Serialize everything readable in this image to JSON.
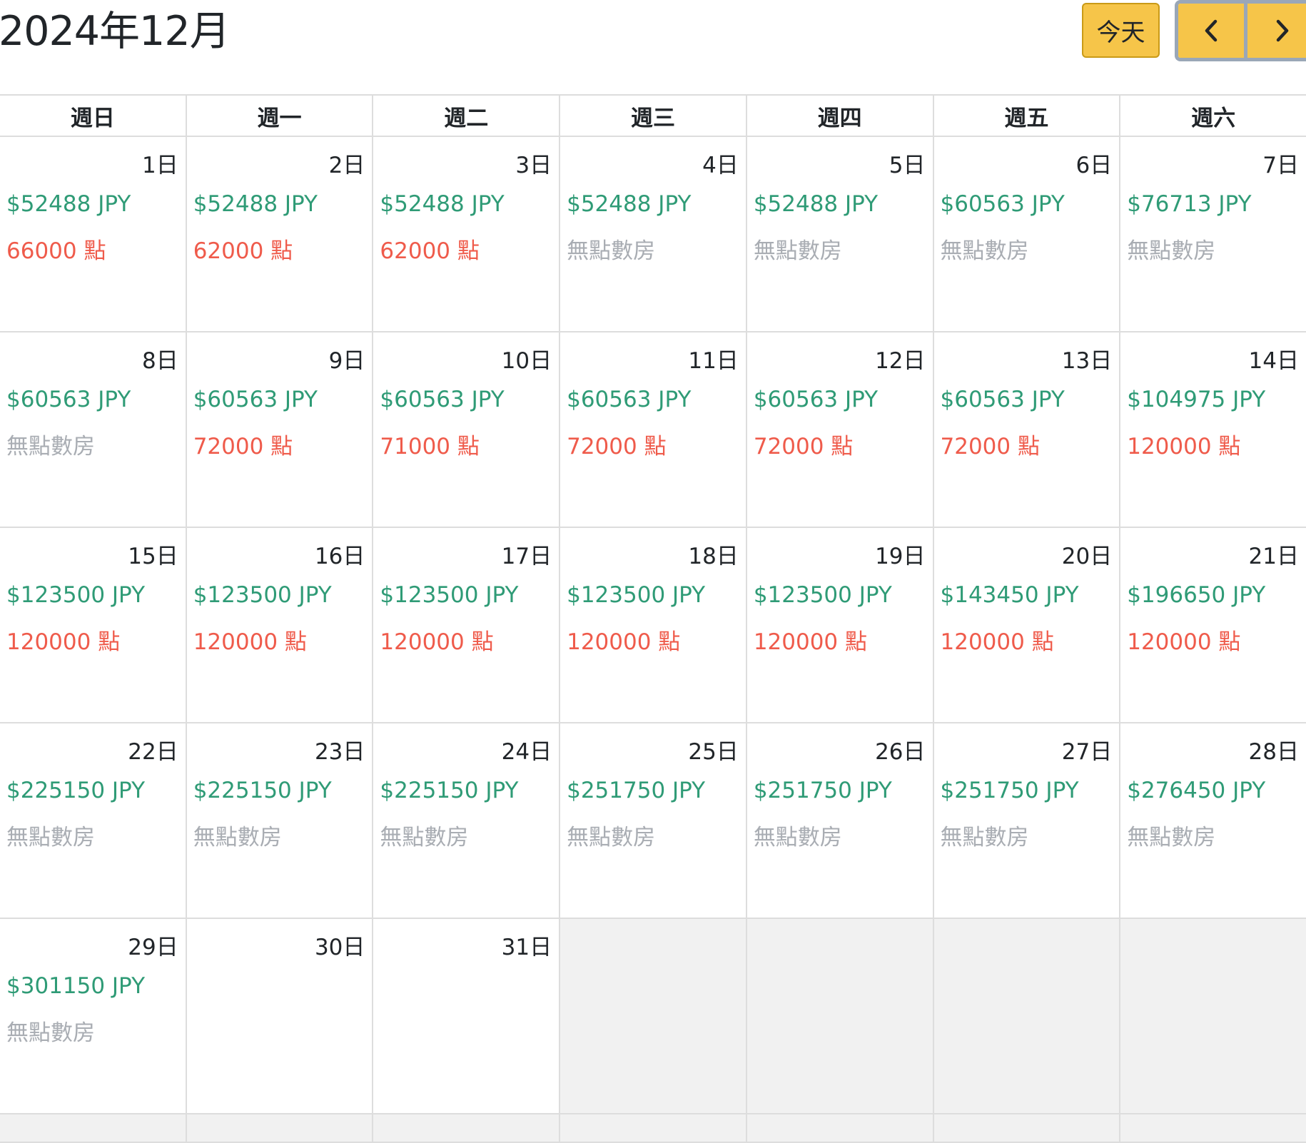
{
  "header": {
    "title": "2024年12月",
    "today_label": "今天",
    "prev_icon": "chevron-left-icon",
    "next_icon": "chevron-right-icon"
  },
  "colors": {
    "button_bg": "#f6c549",
    "price": "#2f9b76",
    "points": "#ef5b4b",
    "no_points": "#a9adb3",
    "empty_cell": "#f1f1f1"
  },
  "weekdays": [
    "週日",
    "週一",
    "週二",
    "週三",
    "週四",
    "週五",
    "週六"
  ],
  "days": [
    {
      "day": "1日",
      "price": "$52488 JPY",
      "points": "66000 點",
      "has_points": true
    },
    {
      "day": "2日",
      "price": "$52488 JPY",
      "points": "62000 點",
      "has_points": true
    },
    {
      "day": "3日",
      "price": "$52488 JPY",
      "points": "62000 點",
      "has_points": true
    },
    {
      "day": "4日",
      "price": "$52488 JPY",
      "points": "無點數房",
      "has_points": false
    },
    {
      "day": "5日",
      "price": "$52488 JPY",
      "points": "無點數房",
      "has_points": false
    },
    {
      "day": "6日",
      "price": "$60563 JPY",
      "points": "無點數房",
      "has_points": false
    },
    {
      "day": "7日",
      "price": "$76713 JPY",
      "points": "無點數房",
      "has_points": false
    },
    {
      "day": "8日",
      "price": "$60563 JPY",
      "points": "無點數房",
      "has_points": false
    },
    {
      "day": "9日",
      "price": "$60563 JPY",
      "points": "72000 點",
      "has_points": true
    },
    {
      "day": "10日",
      "price": "$60563 JPY",
      "points": "71000 點",
      "has_points": true
    },
    {
      "day": "11日",
      "price": "$60563 JPY",
      "points": "72000 點",
      "has_points": true
    },
    {
      "day": "12日",
      "price": "$60563 JPY",
      "points": "72000 點",
      "has_points": true
    },
    {
      "day": "13日",
      "price": "$60563 JPY",
      "points": "72000 點",
      "has_points": true
    },
    {
      "day": "14日",
      "price": "$104975 JPY",
      "points": "120000 點",
      "has_points": true
    },
    {
      "day": "15日",
      "price": "$123500 JPY",
      "points": "120000 點",
      "has_points": true
    },
    {
      "day": "16日",
      "price": "$123500 JPY",
      "points": "120000 點",
      "has_points": true
    },
    {
      "day": "17日",
      "price": "$123500 JPY",
      "points": "120000 點",
      "has_points": true
    },
    {
      "day": "18日",
      "price": "$123500 JPY",
      "points": "120000 點",
      "has_points": true
    },
    {
      "day": "19日",
      "price": "$123500 JPY",
      "points": "120000 點",
      "has_points": true
    },
    {
      "day": "20日",
      "price": "$143450 JPY",
      "points": "120000 點",
      "has_points": true
    },
    {
      "day": "21日",
      "price": "$196650 JPY",
      "points": "120000 點",
      "has_points": true
    },
    {
      "day": "22日",
      "price": "$225150 JPY",
      "points": "無點數房",
      "has_points": false
    },
    {
      "day": "23日",
      "price": "$225150 JPY",
      "points": "無點數房",
      "has_points": false
    },
    {
      "day": "24日",
      "price": "$225150 JPY",
      "points": "無點數房",
      "has_points": false
    },
    {
      "day": "25日",
      "price": "$251750 JPY",
      "points": "無點數房",
      "has_points": false
    },
    {
      "day": "26日",
      "price": "$251750 JPY",
      "points": "無點數房",
      "has_points": false
    },
    {
      "day": "27日",
      "price": "$251750 JPY",
      "points": "無點數房",
      "has_points": false
    },
    {
      "day": "28日",
      "price": "$276450 JPY",
      "points": "無點數房",
      "has_points": false
    },
    {
      "day": "29日",
      "price": "$301150 JPY",
      "points": "無點數房",
      "has_points": false
    },
    {
      "day": "30日",
      "price": "",
      "points": "",
      "has_points": false
    },
    {
      "day": "31日",
      "price": "",
      "points": "",
      "has_points": false
    }
  ]
}
